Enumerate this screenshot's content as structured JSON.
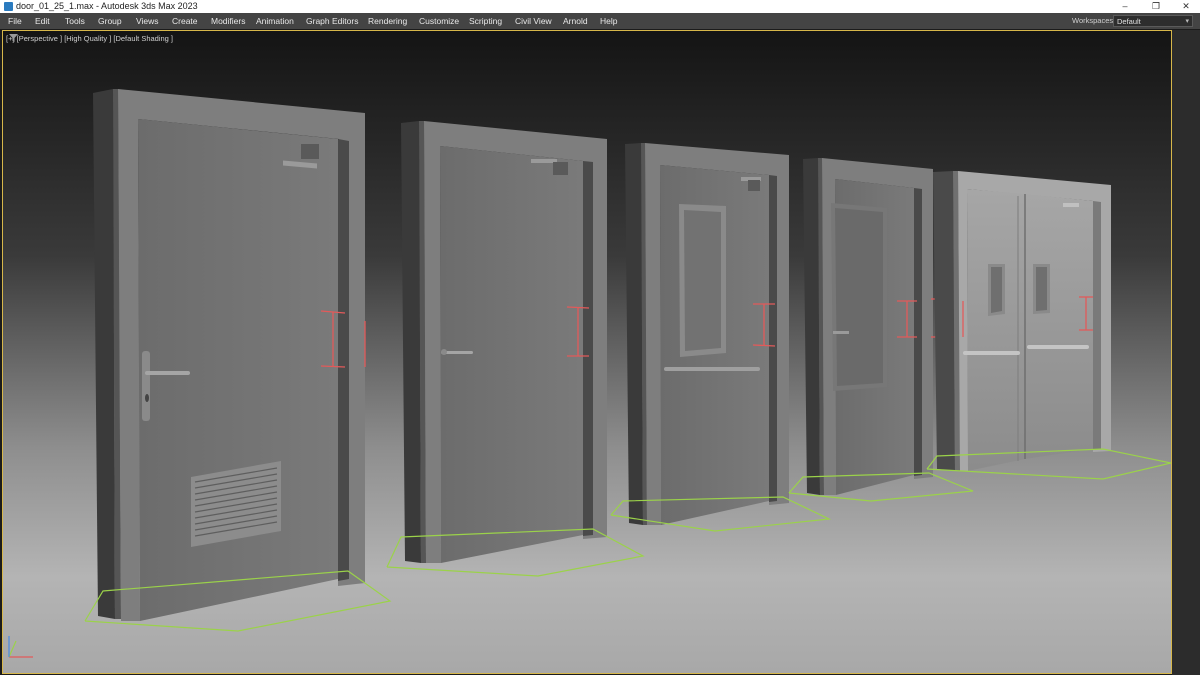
{
  "window": {
    "title": "door_01_25_1.max - Autodesk 3ds Max 2023",
    "app_icon": "3ds-max-app-icon",
    "controls": {
      "minimize": "–",
      "maximize": "❐",
      "close": "✕"
    }
  },
  "menu": {
    "items": [
      "File",
      "Edit",
      "Tools",
      "Group",
      "Views",
      "Create",
      "Modifiers",
      "Animation",
      "Graph Editors",
      "Rendering",
      "Customize",
      "Scripting",
      "Civil View",
      "Arnold",
      "Help"
    ],
    "workspaces_label": "Workspaces:",
    "workspace_value": "Default"
  },
  "viewport": {
    "labels": [
      "[+]",
      "[Perspective ]",
      "[High Quality ]",
      "[Default Shading ]"
    ],
    "border_color": "#d7b74a",
    "selection_color": "#9bd24a",
    "marker_color": "#e25a5a"
  },
  "scene": {
    "object_count_visible": 5
  }
}
